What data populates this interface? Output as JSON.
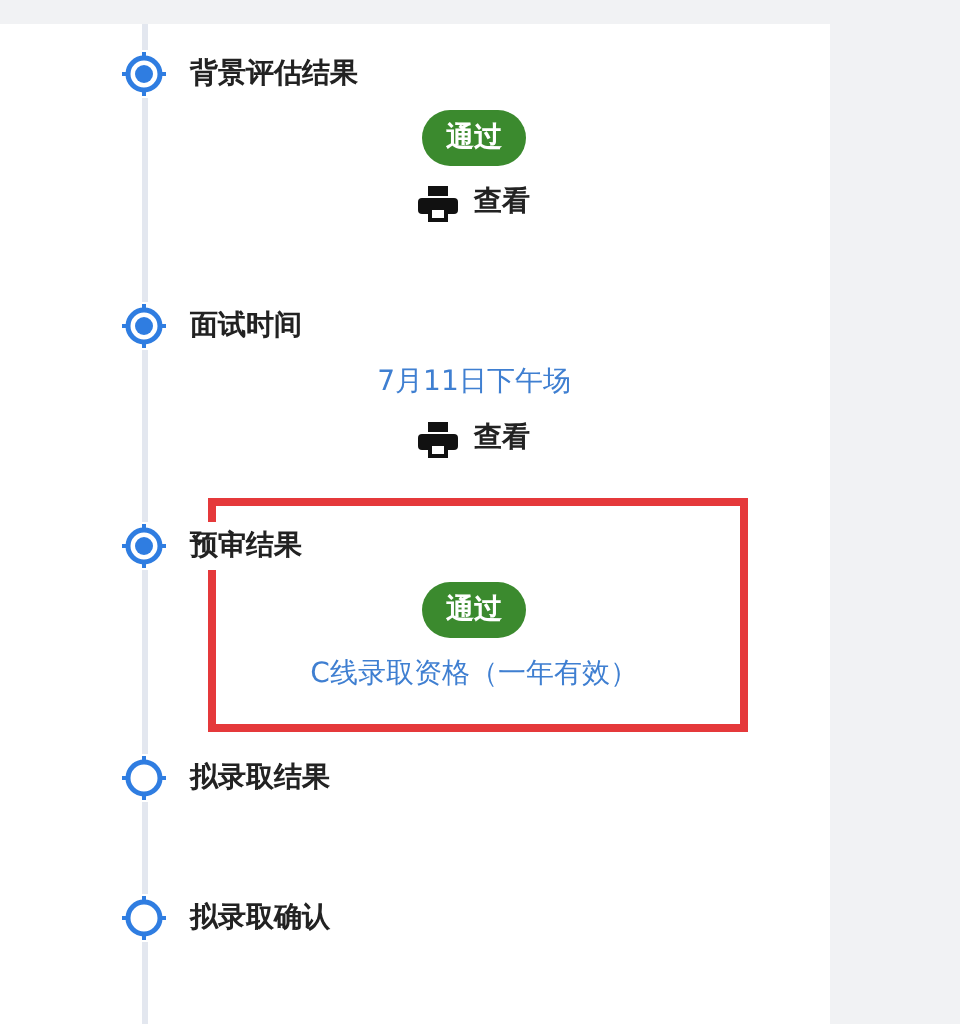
{
  "steps": [
    {
      "title": "背景评估结果",
      "completed": true,
      "highlighted": false,
      "details": [
        {
          "kind": "badge",
          "text": "通过"
        },
        {
          "kind": "view",
          "text": "查看"
        }
      ]
    },
    {
      "title": "面试时间",
      "completed": true,
      "highlighted": false,
      "details": [
        {
          "kind": "link",
          "text": "7月11日下午场"
        },
        {
          "kind": "view",
          "text": "查看"
        }
      ]
    },
    {
      "title": "预审结果",
      "completed": true,
      "highlighted": true,
      "details": [
        {
          "kind": "badge",
          "text": "通过"
        },
        {
          "kind": "link",
          "text": "C线录取资格（一年有效）"
        }
      ]
    },
    {
      "title": "拟录取结果",
      "completed": false,
      "highlighted": false
    },
    {
      "title": "拟录取确认",
      "completed": false,
      "highlighted": false
    }
  ]
}
